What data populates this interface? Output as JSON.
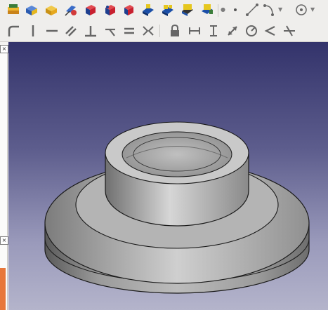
{
  "toolbars": {
    "top": [
      {
        "name": "part-design-workbench-icon",
        "color": "#e8a317"
      },
      {
        "name": "new-body-icon",
        "color": "#3766c8"
      },
      {
        "name": "create-part-icon",
        "color": "#e6b71e"
      },
      {
        "name": "attach-icon",
        "color": "#d23b3b"
      },
      {
        "name": "pad-icon",
        "color": "#c8202f"
      },
      {
        "name": "revolution-icon",
        "color": "#c8202f"
      },
      {
        "name": "pocket-icon",
        "color": "#c8202f"
      },
      {
        "name": "datum-plane-icon",
        "color": "#1b4fa8"
      },
      {
        "name": "datum-line-icon",
        "color": "#1b4fa8"
      },
      {
        "name": "datum-point-icon",
        "color": "#e6c71e"
      },
      {
        "name": "shape-binder-icon",
        "color": "#e6c71e"
      }
    ],
    "sketcher": [
      "fillet-icon",
      "vertical-constraint-icon",
      "horizontal-constraint-icon",
      "parallel-constraint-icon",
      "perpendicular-constraint-icon",
      "tangent-constraint-icon",
      "equal-constraint-icon",
      "symmetric-constraint-icon",
      "lock-constraint-icon",
      "horizontal-distance-icon",
      "vertical-distance-icon",
      "distance-constraint-icon",
      "radius-constraint-icon",
      "angle-constraint-icon",
      "snell-law-icon"
    ]
  },
  "panel": {
    "close_label": "×"
  },
  "viewport": {
    "object": "revolved-flanged-part",
    "background_top": "#33336b",
    "background_bottom": "#b4b4cb",
    "shape_color": "#b8b8b8"
  }
}
